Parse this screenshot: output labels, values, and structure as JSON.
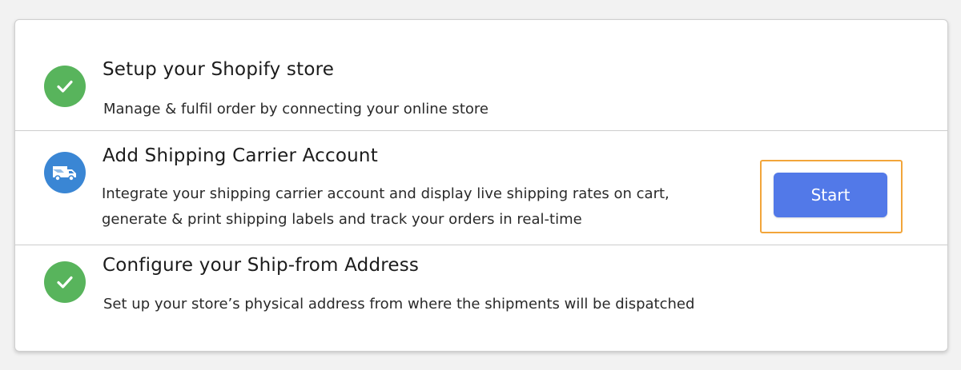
{
  "colors": {
    "done_green": "#58b45c",
    "active_blue": "#3a86d4",
    "button_blue": "#5279e8",
    "highlight_orange": "#f2a53a"
  },
  "steps": [
    {
      "status": "completed",
      "icon": "check-icon",
      "title": "Setup your Shopify store",
      "description": "Manage & fulfil order by connecting your online store"
    },
    {
      "status": "active",
      "icon": "delivery-truck-icon",
      "title": "Add Shipping Carrier Account",
      "description_line1": "Integrate your shipping carrier account and display live shipping rates on cart,",
      "description_line2": "generate & print shipping labels and track your orders in real-time",
      "button_label": "Start"
    },
    {
      "status": "completed",
      "icon": "check-icon",
      "title": "Configure your Ship-from Address",
      "description": "Set up your store’s physical address from where the shipments will be dispatched"
    }
  ]
}
